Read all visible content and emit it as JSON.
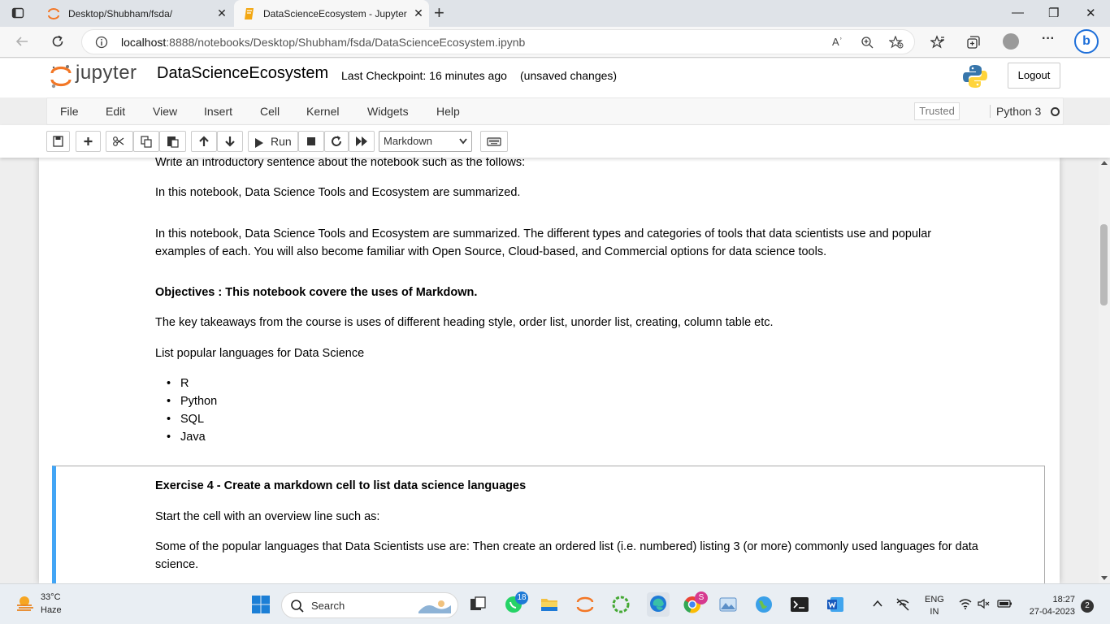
{
  "browser": {
    "tabs": [
      {
        "label": "Desktop/Shubham/fsda/",
        "active": false
      },
      {
        "label": "DataScienceEcosystem - Jupyter",
        "active": true
      }
    ],
    "close_glyph": "✕",
    "new_tab_glyph": "+",
    "window_controls": {
      "minimize": "—",
      "restore": "❐",
      "close": "✕"
    },
    "url_host": "localhost",
    "url_rest": ":8888/notebooks/Desktop/Shubham/fsda/DataScienceEcosystem.ipynb",
    "read_aloud_label": "Aʾ",
    "more_glyph": "···",
    "bing_label": "b"
  },
  "jupyter": {
    "logo_text": "jupyter",
    "notebook_name": "DataScienceEcosystem",
    "checkpoint": "Last Checkpoint: 16 minutes ago",
    "status": "(unsaved changes)",
    "logout_label": "Logout",
    "menu": [
      "File",
      "Edit",
      "View",
      "Insert",
      "Cell",
      "Kernel",
      "Widgets",
      "Help"
    ],
    "trusted_label": "Trusted",
    "kernel_name": "Python 3",
    "toolbar": {
      "run_label": "Run",
      "cell_type": "Markdown"
    }
  },
  "notebook": {
    "intro_instruction": "Write an introductory sentence about the notebook such as the follows:",
    "intro_example": "In this notebook, Data Science Tools and Ecosystem are summarized.",
    "intro_para_line1": "In this notebook, Data Science Tools and Ecosystem are summarized. The different types and categories of tools that data scientists use and popular",
    "intro_para_line2": "examples of each. You will also become familiar with Open Source, Cloud-based, and Commercial options for data science tools.",
    "objectives": "Objectives : This notebook covere the uses of Markdown.",
    "takeaways": "The key takeaways from the course is uses of different heading style, order list, unorder list, creating, column table etc.",
    "languages_heading": "List popular languages for Data Science",
    "languages": [
      "R",
      "Python",
      "SQL",
      "Java"
    ],
    "exercise_title": "Exercise 4 - Create a markdown cell to list data science languages",
    "exercise_line1": "Start the cell with an overview line such as:",
    "exercise_line2a": "Some of the popular languages that Data Scientists use are: Then create an ordered list (i.e. numbered) listing 3 (or more) commonly used languages for data",
    "exercise_line2b": "science."
  },
  "taskbar": {
    "temperature": "33°C",
    "weather": "Haze",
    "search_label": "Search",
    "whatsapp_badge": "18",
    "chrome_badge": "S",
    "language_line1": "ENG",
    "language_line2": "IN",
    "time": "18:27",
    "date": "27-04-2023",
    "notification_count": "2"
  },
  "colors": {
    "selected_cell_border": "#42a5f5",
    "jupyter_orange": "#f37726",
    "edge_blue": "#1e7ad6"
  }
}
